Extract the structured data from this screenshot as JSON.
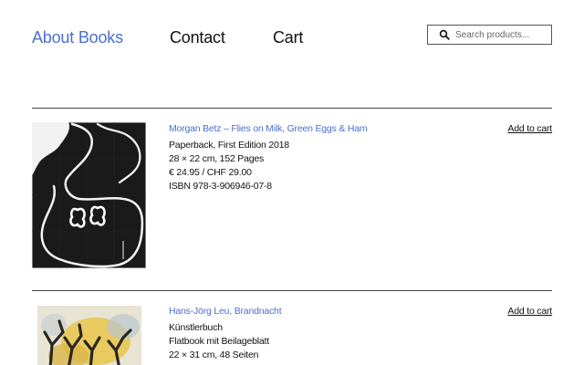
{
  "nav": {
    "about": "About Books",
    "contact": "Contact",
    "cart": "Cart"
  },
  "search": {
    "placeholder": "Search products..."
  },
  "products": [
    {
      "title": "Morgan Betz – Flies on Milk, Green Eggs & Ham",
      "details": [
        "Paperback, First Edition 2018",
        "28 × 22 cm, 152 Pages",
        "€ 24.95 / CHF 29.00",
        "ISBN 978-3-906946-07-8"
      ],
      "add_to_cart": "Add to cart"
    },
    {
      "title": "Hans-Jörg Leu, Brandnacht",
      "details": [
        "Künstlerbuch",
        "Flatbook mit Beilageblatt",
        "22 × 31 cm, 48 Seiten"
      ],
      "add_to_cart": "Add to cart"
    }
  ],
  "colors": {
    "link": "#4a6fcf",
    "text": "#111111",
    "divider": "#444444"
  }
}
